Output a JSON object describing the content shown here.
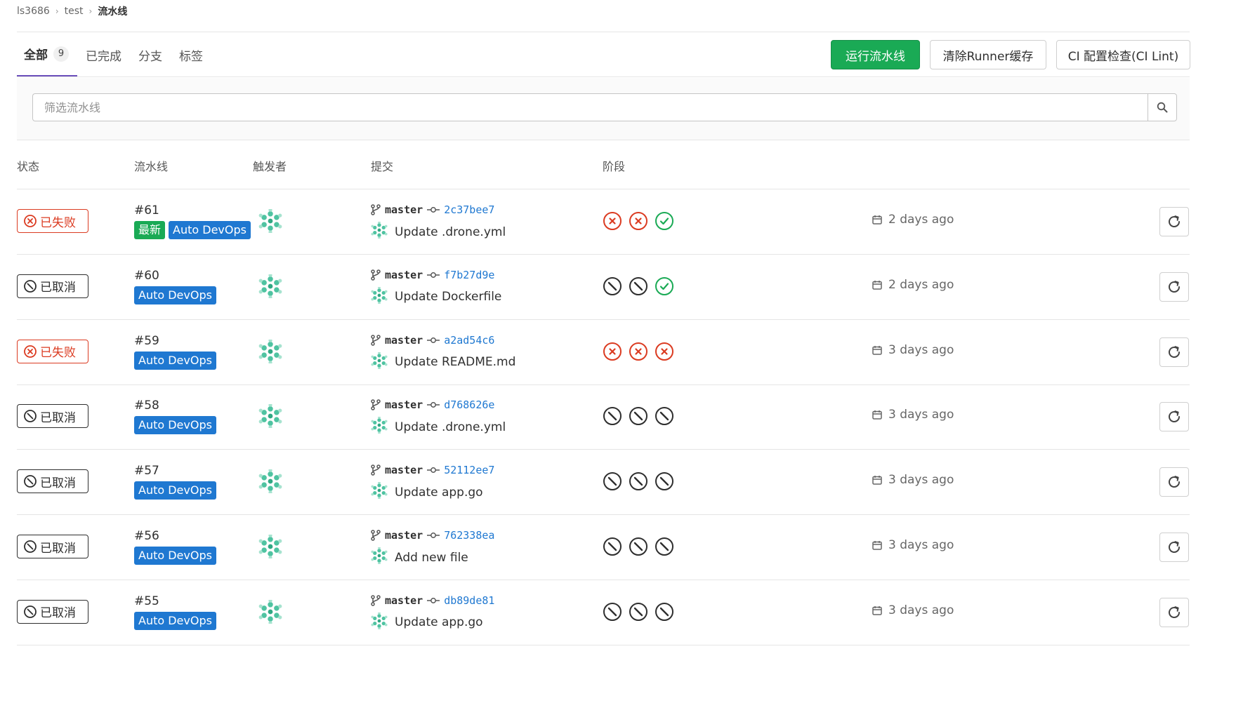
{
  "breadcrumb": {
    "group": "ls3686",
    "project": "test",
    "current": "流水线"
  },
  "tabs": [
    {
      "label": "全部",
      "count": "9"
    },
    {
      "label": "已完成"
    },
    {
      "label": "分支"
    },
    {
      "label": "标签"
    }
  ],
  "actions": {
    "run": "运行流水线",
    "clear_cache": "清除Runner缓存",
    "ci_lint": "CI 配置检查(CI Lint)"
  },
  "filter": {
    "placeholder": "筛选流水线"
  },
  "columns": {
    "status": "状态",
    "pipeline": "流水线",
    "triggerer": "触发者",
    "commit": "提交",
    "stages": "阶段"
  },
  "colors": {
    "failed": "#db3b21",
    "canceled": "#2e2e2e",
    "success": "#1aaa55",
    "latest_badge": "#1aaa55",
    "devops_badge": "#1f78d1",
    "link": "#1f78d1",
    "active_tab": "#6b4fbb"
  },
  "rows": [
    {
      "status": "已失败",
      "status_type": "failed",
      "id": "#61",
      "latest": "最新",
      "tag": "Auto DevOps",
      "branch": "master",
      "sha": "2c37bee7",
      "message": "Update .drone.yml",
      "stages": [
        "failed",
        "failed",
        "success"
      ],
      "time": "2 days ago"
    },
    {
      "status": "已取消",
      "status_type": "canceled",
      "id": "#60",
      "tag": "Auto DevOps",
      "branch": "master",
      "sha": "f7b27d9e",
      "message": "Update Dockerfile",
      "stages": [
        "canceled",
        "canceled",
        "success"
      ],
      "time": "2 days ago"
    },
    {
      "status": "已失败",
      "status_type": "failed",
      "id": "#59",
      "tag": "Auto DevOps",
      "branch": "master",
      "sha": "a2ad54c6",
      "message": "Update README.md",
      "stages": [
        "failed",
        "failed",
        "failed"
      ],
      "time": "3 days ago"
    },
    {
      "status": "已取消",
      "status_type": "canceled",
      "id": "#58",
      "tag": "Auto DevOps",
      "branch": "master",
      "sha": "d768626e",
      "message": "Update .drone.yml",
      "stages": [
        "canceled",
        "canceled",
        "canceled"
      ],
      "time": "3 days ago"
    },
    {
      "status": "已取消",
      "status_type": "canceled",
      "id": "#57",
      "tag": "Auto DevOps",
      "branch": "master",
      "sha": "52112ee7",
      "message": "Update app.go",
      "stages": [
        "canceled",
        "canceled",
        "canceled"
      ],
      "time": "3 days ago"
    },
    {
      "status": "已取消",
      "status_type": "canceled",
      "id": "#56",
      "tag": "Auto DevOps",
      "branch": "master",
      "sha": "762338ea",
      "message": "Add new file",
      "stages": [
        "canceled",
        "canceled",
        "canceled"
      ],
      "time": "3 days ago"
    },
    {
      "status": "已取消",
      "status_type": "canceled",
      "id": "#55",
      "tag": "Auto DevOps",
      "branch": "master",
      "sha": "db89de81",
      "message": "Update app.go",
      "stages": [
        "canceled",
        "canceled",
        "canceled"
      ],
      "time": "3 days ago"
    }
  ]
}
